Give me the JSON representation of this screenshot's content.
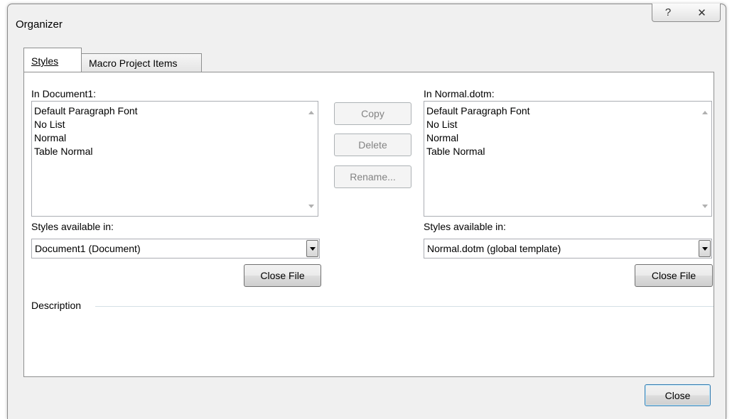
{
  "dialog": {
    "title": "Organizer",
    "help_glyph": "?",
    "close_glyph": "✕"
  },
  "tabs": [
    {
      "label": "Styles",
      "selected": true
    },
    {
      "label": "Macro Project Items",
      "selected": false
    }
  ],
  "left": {
    "label": "In Document1:",
    "items": [
      "Default Paragraph Font",
      "No List",
      "Normal",
      "Table Normal"
    ],
    "available_label": "Styles available in:",
    "available_value": "Document1 (Document)",
    "close_file_label": "Close File"
  },
  "right": {
    "label": "In Normal.dotm:",
    "items": [
      "Default Paragraph Font",
      "No List",
      "Normal",
      "Table Normal"
    ],
    "available_label": "Styles available in:",
    "available_value": "Normal.dotm (global template)",
    "close_file_label": "Close File"
  },
  "actions": {
    "copy": "Copy",
    "delete": "Delete",
    "rename": "Rename..."
  },
  "description_label": "Description",
  "close_button": "Close"
}
